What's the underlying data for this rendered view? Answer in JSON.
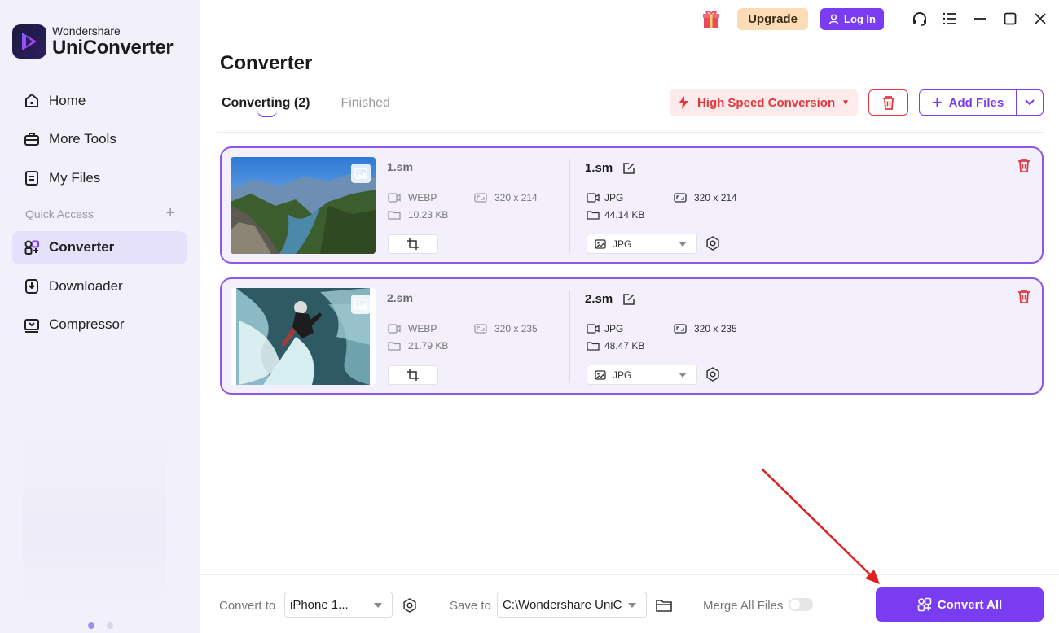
{
  "app": {
    "brand": "Wondershare",
    "product": "UniConverter"
  },
  "sidebar": {
    "items": [
      {
        "label": "Home",
        "icon": "home-icon"
      },
      {
        "label": "More Tools",
        "icon": "toolbox-icon"
      },
      {
        "label": "My Files",
        "icon": "file-icon"
      }
    ],
    "quick_access_label": "Quick Access",
    "quick_access_add": "+",
    "tools": [
      {
        "label": "Converter",
        "icon": "converter-icon",
        "active": true
      },
      {
        "label": "Downloader",
        "icon": "downloader-icon"
      },
      {
        "label": "Compressor",
        "icon": "compressor-icon"
      }
    ]
  },
  "topbar": {
    "upgrade_label": "Upgrade",
    "login_label": "Log In"
  },
  "main": {
    "title": "Converter",
    "tabs": [
      {
        "label": "Converting (2)",
        "active": true
      },
      {
        "label": "Finished",
        "active": false
      }
    ],
    "high_speed_label": "High Speed Conversion",
    "add_files_label": "Add Files"
  },
  "files": [
    {
      "source_name": "1.sm",
      "source_format": "WEBP",
      "source_resolution": "320 x 214",
      "source_size": "10.23 KB",
      "output_name": "1.sm",
      "output_format": "JPG",
      "output_resolution": "320 x 214",
      "output_size": "44.14 KB",
      "selected_format": "JPG"
    },
    {
      "source_name": "2.sm",
      "source_format": "WEBP",
      "source_resolution": "320 x 235",
      "source_size": "21.79 KB",
      "output_name": "2.sm",
      "output_format": "JPG",
      "output_resolution": "320 x 235",
      "output_size": "48.47 KB",
      "selected_format": "JPG"
    }
  ],
  "bottombar": {
    "convert_to_label": "Convert to",
    "convert_to_value": "iPhone 1...",
    "save_to_label": "Save to",
    "save_to_value": "C:\\Wondershare UniCo",
    "merge_label": "Merge All Files",
    "merge_enabled": false,
    "convert_all_label": "Convert All"
  },
  "colors": {
    "accent": "#7a3cf0",
    "danger": "#e0383e",
    "sidebar_bg": "#f2f0fa",
    "card_border": "#8c58e8",
    "annotation_arrow": "#e02020"
  }
}
